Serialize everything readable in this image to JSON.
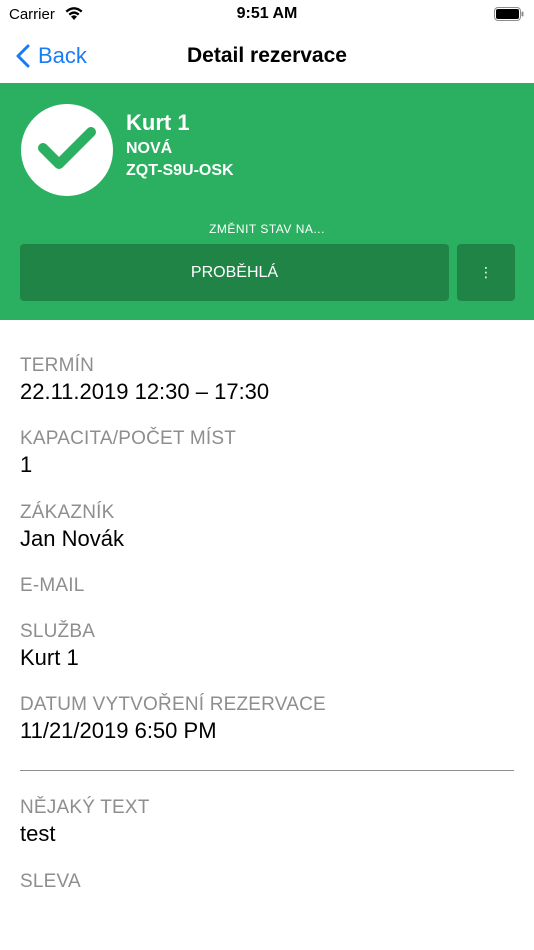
{
  "status_bar": {
    "carrier": "Carrier",
    "time": "9:51 AM"
  },
  "nav": {
    "back_label": "Back",
    "title": "Detail rezervace"
  },
  "reservation": {
    "court": "Kurt 1",
    "state": "NOVÁ",
    "code": "ZQT-S9U-OSK",
    "change_state_label": "ZMĚNIT STAV NA...",
    "primary_action": "PROBĚHLÁ",
    "more_action": "⋮"
  },
  "details": [
    {
      "label": "TERMÍN",
      "value": "22.11.2019 12:30 – 17:30"
    },
    {
      "label": "KAPACITA/POČET MÍST",
      "value": "1"
    },
    {
      "label": "ZÁKAZNÍK",
      "value": "Jan Novák"
    },
    {
      "label": "E-MAIL",
      "value": ""
    },
    {
      "label": "SLUŽBA",
      "value": "Kurt 1"
    },
    {
      "label": "DATUM VYTVOŘENÍ REZERVACE",
      "value": "11/21/2019 6:50 PM"
    },
    {
      "label": "NĚJAKÝ TEXT",
      "value": "test"
    },
    {
      "label": "SLEVA",
      "value": ""
    }
  ],
  "colors": {
    "accent_blue": "#1a7cf5",
    "header_green": "#2ab060",
    "button_green": "#218447",
    "label_gray": "#8e8e8e"
  }
}
